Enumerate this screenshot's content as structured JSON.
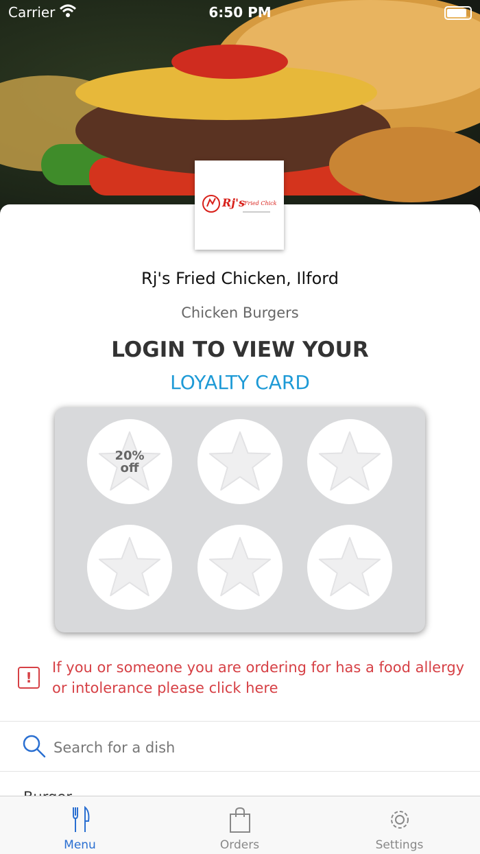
{
  "status_bar": {
    "carrier": "Carrier",
    "time": "6:50 PM"
  },
  "restaurant": {
    "name": "Rj's Fried Chicken, Ilford",
    "cuisine": "Chicken Burgers",
    "logo_text": "Rj's",
    "logo_sub": "Fried Chicken"
  },
  "loyalty": {
    "heading": "LOGIN TO VIEW YOUR",
    "subheading": "LOYALTY CARD",
    "stamps": [
      {
        "label": "20% off"
      },
      {
        "label": ""
      },
      {
        "label": ""
      },
      {
        "label": ""
      },
      {
        "label": ""
      },
      {
        "label": ""
      }
    ]
  },
  "allergy": {
    "icon": "alert-icon",
    "text": "If you or someone you are ordering for has a food allergy or intolerance please click here"
  },
  "search": {
    "placeholder": "Search for a dish"
  },
  "menu_peek": "Burger",
  "tabbar": {
    "tabs": [
      {
        "label": "Menu",
        "icon": "cutlery-icon",
        "active": true
      },
      {
        "label": "Orders",
        "icon": "bag-icon",
        "active": false
      },
      {
        "label": "Settings",
        "icon": "gear-icon",
        "active": false
      }
    ]
  },
  "colors": {
    "accent": "#1e9ad6",
    "alert": "#d64045",
    "tab_active": "#2a6fd1",
    "card_bg": "#d8d9db"
  }
}
